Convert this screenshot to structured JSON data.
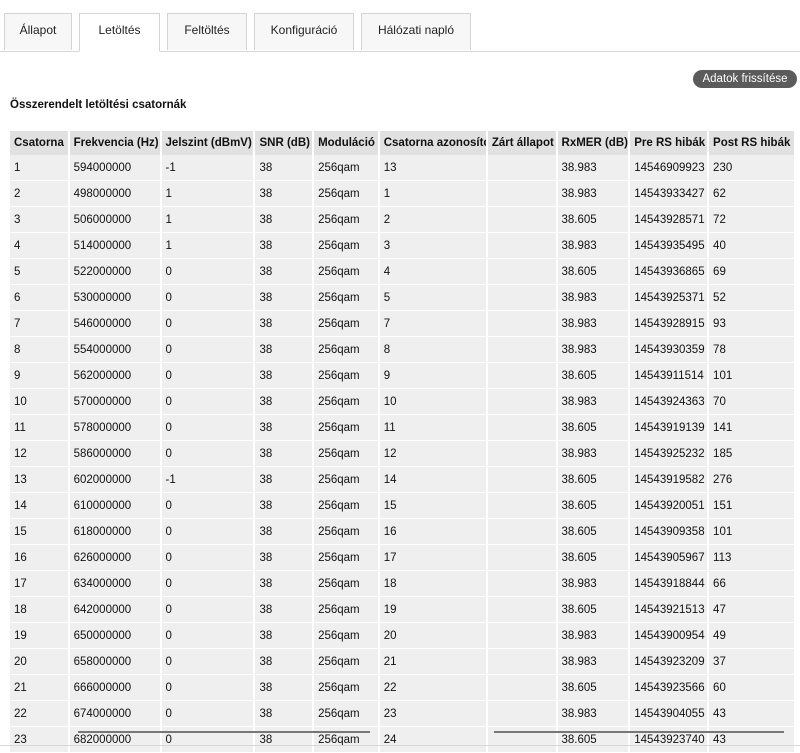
{
  "tabs": [
    {
      "label": "Állapot"
    },
    {
      "label": "Letöltés"
    },
    {
      "label": "Feltöltés"
    },
    {
      "label": "Konfiguráció"
    },
    {
      "label": "Hálózati napló"
    }
  ],
  "refresh_button": {
    "label": "Adatok frissítése"
  },
  "section_title": "Összerendelt letöltési csatornák",
  "table": {
    "headers": [
      "Csatorna",
      "Frekvencia (Hz)",
      "Jelszint (dBmV)",
      "SNR (dB)",
      "Moduláció",
      "Csatorna azonosító",
      "Zárt állapot",
      "RxMER (dB)",
      "Pre RS hibák",
      "Post RS hibák"
    ],
    "rows": [
      [
        "1",
        "594000000",
        "-1",
        "38",
        "256qam",
        "13",
        "",
        "38.983",
        "14546909923",
        "230"
      ],
      [
        "2",
        "498000000",
        "1",
        "38",
        "256qam",
        "1",
        "",
        "38.983",
        "14543933427",
        "62"
      ],
      [
        "3",
        "506000000",
        "1",
        "38",
        "256qam",
        "2",
        "",
        "38.605",
        "14543928571",
        "72"
      ],
      [
        "4",
        "514000000",
        "1",
        "38",
        "256qam",
        "3",
        "",
        "38.983",
        "14543935495",
        "40"
      ],
      [
        "5",
        "522000000",
        "0",
        "38",
        "256qam",
        "4",
        "",
        "38.605",
        "14543936865",
        "69"
      ],
      [
        "6",
        "530000000",
        "0",
        "38",
        "256qam",
        "5",
        "",
        "38.983",
        "14543925371",
        "52"
      ],
      [
        "7",
        "546000000",
        "0",
        "38",
        "256qam",
        "7",
        "",
        "38.983",
        "14543928915",
        "93"
      ],
      [
        "8",
        "554000000",
        "0",
        "38",
        "256qam",
        "8",
        "",
        "38.983",
        "14543930359",
        "78"
      ],
      [
        "9",
        "562000000",
        "0",
        "38",
        "256qam",
        "9",
        "",
        "38.605",
        "14543911514",
        "101"
      ],
      [
        "10",
        "570000000",
        "0",
        "38",
        "256qam",
        "10",
        "",
        "38.983",
        "14543924363",
        "70"
      ],
      [
        "11",
        "578000000",
        "0",
        "38",
        "256qam",
        "11",
        "",
        "38.605",
        "14543919139",
        "141"
      ],
      [
        "12",
        "586000000",
        "0",
        "38",
        "256qam",
        "12",
        "",
        "38.983",
        "14543925232",
        "185"
      ],
      [
        "13",
        "602000000",
        "-1",
        "38",
        "256qam",
        "14",
        "",
        "38.605",
        "14543919582",
        "276"
      ],
      [
        "14",
        "610000000",
        "0",
        "38",
        "256qam",
        "15",
        "",
        "38.605",
        "14543920051",
        "151"
      ],
      [
        "15",
        "618000000",
        "0",
        "38",
        "256qam",
        "16",
        "",
        "38.605",
        "14543909358",
        "101"
      ],
      [
        "16",
        "626000000",
        "0",
        "38",
        "256qam",
        "17",
        "",
        "38.605",
        "14543905967",
        "113"
      ],
      [
        "17",
        "634000000",
        "0",
        "38",
        "256qam",
        "18",
        "",
        "38.983",
        "14543918844",
        "66"
      ],
      [
        "18",
        "642000000",
        "0",
        "38",
        "256qam",
        "19",
        "",
        "38.605",
        "14543921513",
        "47"
      ],
      [
        "19",
        "650000000",
        "0",
        "38",
        "256qam",
        "20",
        "",
        "38.983",
        "14543900954",
        "49"
      ],
      [
        "20",
        "658000000",
        "0",
        "38",
        "256qam",
        "21",
        "",
        "38.983",
        "14543923209",
        "37"
      ],
      [
        "21",
        "666000000",
        "0",
        "38",
        "256qam",
        "22",
        "",
        "38.605",
        "14543923566",
        "60"
      ],
      [
        "22",
        "674000000",
        "0",
        "38",
        "256qam",
        "23",
        "",
        "38.983",
        "14543904055",
        "43"
      ],
      [
        "23",
        "682000000",
        "0",
        "38",
        "256qam",
        "24",
        "",
        "38.605",
        "14543923740",
        "43"
      ]
    ]
  }
}
